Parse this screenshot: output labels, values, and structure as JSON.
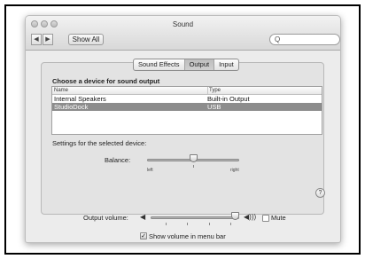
{
  "window": {
    "title": "Sound",
    "show_all_label": "Show All",
    "back_glyph": "◀",
    "forward_glyph": "▶",
    "search_icon": "magnifier-icon",
    "search_glyph": "Q",
    "search_placeholder": ""
  },
  "tabs": [
    {
      "label": "Sound Effects",
      "active": false
    },
    {
      "label": "Output",
      "active": true
    },
    {
      "label": "Input",
      "active": false
    }
  ],
  "output": {
    "heading": "Choose a device for sound output",
    "columns": [
      "Name",
      "Type"
    ],
    "devices": [
      {
        "name": "Internal Speakers",
        "type": "Built-in Output",
        "selected": false
      },
      {
        "name": "StudioDock",
        "type": "USB",
        "selected": true
      }
    ],
    "settings_label": "Settings for the selected device:",
    "balance_label": "Balance:",
    "balance_left": "left",
    "balance_right": "right",
    "balance_value": 0.5,
    "help_glyph": "?"
  },
  "volume": {
    "label": "Output volume:",
    "level": 0.95,
    "low_icon": "speaker-low-icon",
    "low_glyph": "◀",
    "high_icon": "speaker-high-icon",
    "high_glyph": "◀)))",
    "mute_label": "Mute",
    "mute_checked": false,
    "show_in_menu_label": "Show volume in menu bar",
    "show_in_menu_checked": true,
    "check_glyph": "✓"
  }
}
